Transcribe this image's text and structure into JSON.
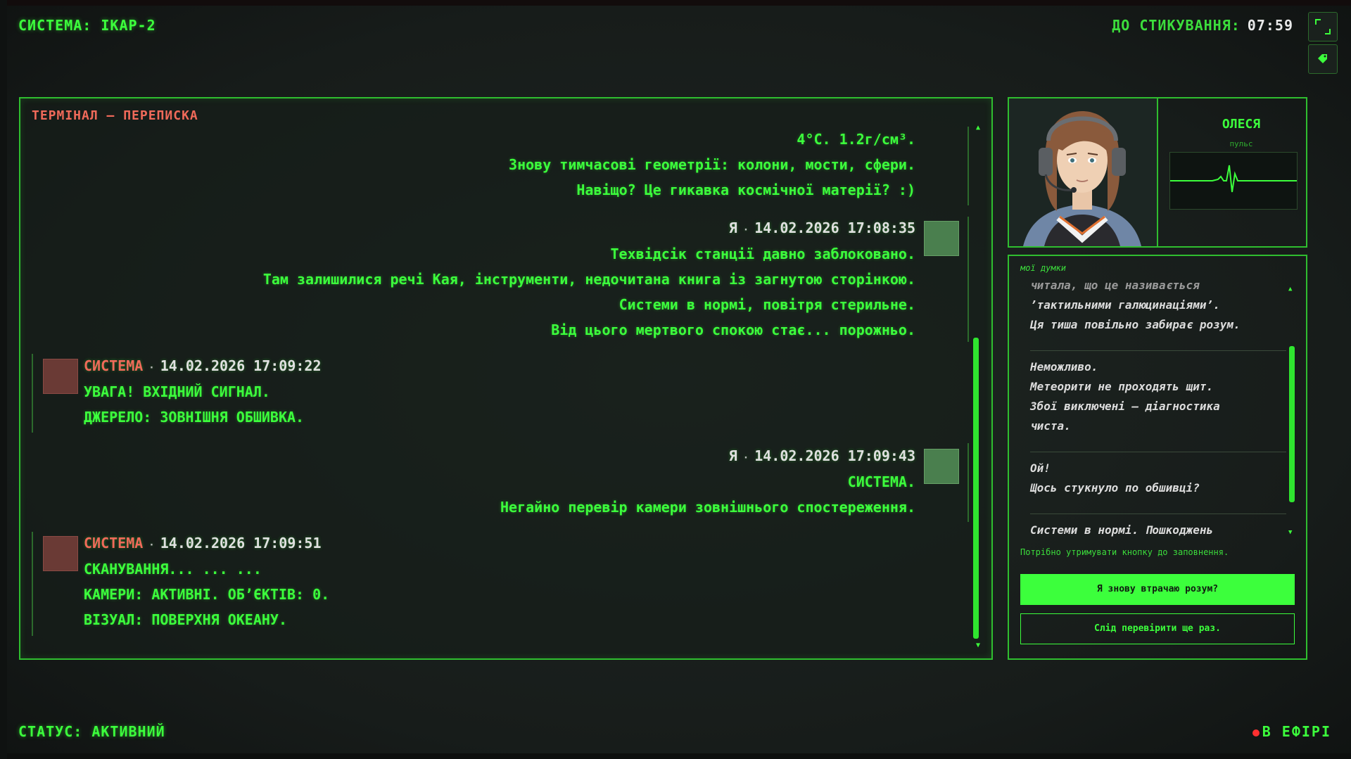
{
  "header": {
    "system_label": "СИСТЕМА: ІКАР-2",
    "docking_label": "ДО СТИКУВАННЯ:",
    "docking_time": "07:59",
    "fullscreen_icon": "fullscreen-icon",
    "tag_icon": "tag-icon"
  },
  "terminal": {
    "title": "ТЕРМІНАЛ — ПЕРЕПИСКА",
    "messages": [
      {
        "author": "",
        "timestamp": "",
        "lines": [
          "4°C. 1.2г/см³.",
          "Знову тимчасові геометрії: колони, мости, сфери.",
          "Навіщо? Це гикавка космічної матерії? :)"
        ]
      },
      {
        "author": "Я",
        "timestamp": "14.02.2026 17:08:35",
        "lines": [
          "Техвідсік станції давно заблоковано.",
          "Там залишилися речі Кая, інструменти, недочитана книга із загнутою сторінкою.",
          "Системи в нормі, повітря стерильне.",
          "Від цього мертвого спокою стає... порожньо."
        ]
      },
      {
        "author": "СИСТЕМА",
        "timestamp": "14.02.2026 17:09:22",
        "lines": [
          "УВАГА! ВХІДНИЙ СИГНАЛ.",
          "ДЖЕРЕЛО: ЗОВНІШНЯ ОБШИВКА."
        ]
      },
      {
        "author": "Я",
        "timestamp": "14.02.2026 17:09:43",
        "lines": [
          "СИСТЕМА.",
          "Негайно перевір камери зовнішнього спостереження."
        ]
      },
      {
        "author": "СИСТЕМА",
        "timestamp": "14.02.2026 17:09:51",
        "lines": [
          "СКАНУВАННЯ... ... ...",
          "КАМЕРИ: АКТИВНІ. ОБ’ЄКТІВ: 0.",
          "ВІЗУАЛ: ПОВЕРХНЯ ОКЕАНУ."
        ]
      }
    ]
  },
  "character": {
    "name": "ОЛЕСЯ",
    "pulse_label": "пульс"
  },
  "thoughts": {
    "title": "мої думки",
    "entries": [
      [
        "читала, що це називається",
        "’тактильними галюцинаціями’.",
        "Ця тиша повільно забирає розум."
      ],
      [
        "Неможливо.",
        "Метеорити не проходять щит.",
        "Збої виключені – діагностика",
        "чиста."
      ],
      [
        "Ой!",
        "Щось стукнуло по обшивці?"
      ],
      [
        "Системи в нормі. Пошкоджень"
      ]
    ],
    "hint": "Потрібно утримувати кнопку до заповнення.",
    "choice_primary": "Я знову втрачаю розум?",
    "choice_secondary": "Слід перевірити ще раз."
  },
  "footer": {
    "status": "СТАТУС: АКТИВНИЙ",
    "on_air": "В ЕФІРІ"
  },
  "colors": {
    "accent": "#3cff3c",
    "system": "#f06a5a",
    "background": "#171c1a"
  }
}
